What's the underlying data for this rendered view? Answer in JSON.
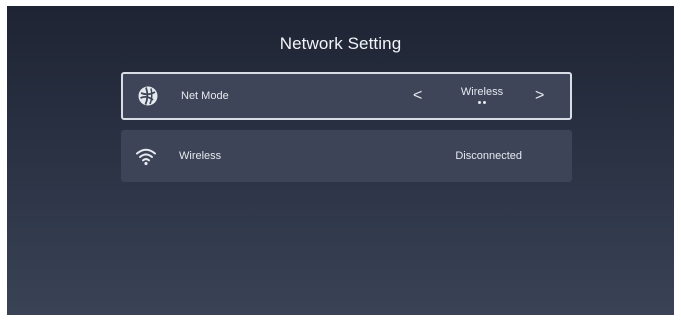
{
  "page": {
    "title": "Network Setting"
  },
  "net_mode": {
    "label": "Net Mode",
    "icon": "globe-icon",
    "value": "Wireless",
    "prev_arrow": "<",
    "next_arrow": ">",
    "option_indicator_count": 2
  },
  "wireless": {
    "label": "Wireless",
    "icon": "wifi-icon",
    "status": "Disconnected"
  },
  "colors": {
    "background_top": "#1e2433",
    "background_bottom": "#3a4356",
    "row_background": "#3e4558",
    "focus_border": "#d9dde6",
    "text": "#e6e9ef"
  }
}
